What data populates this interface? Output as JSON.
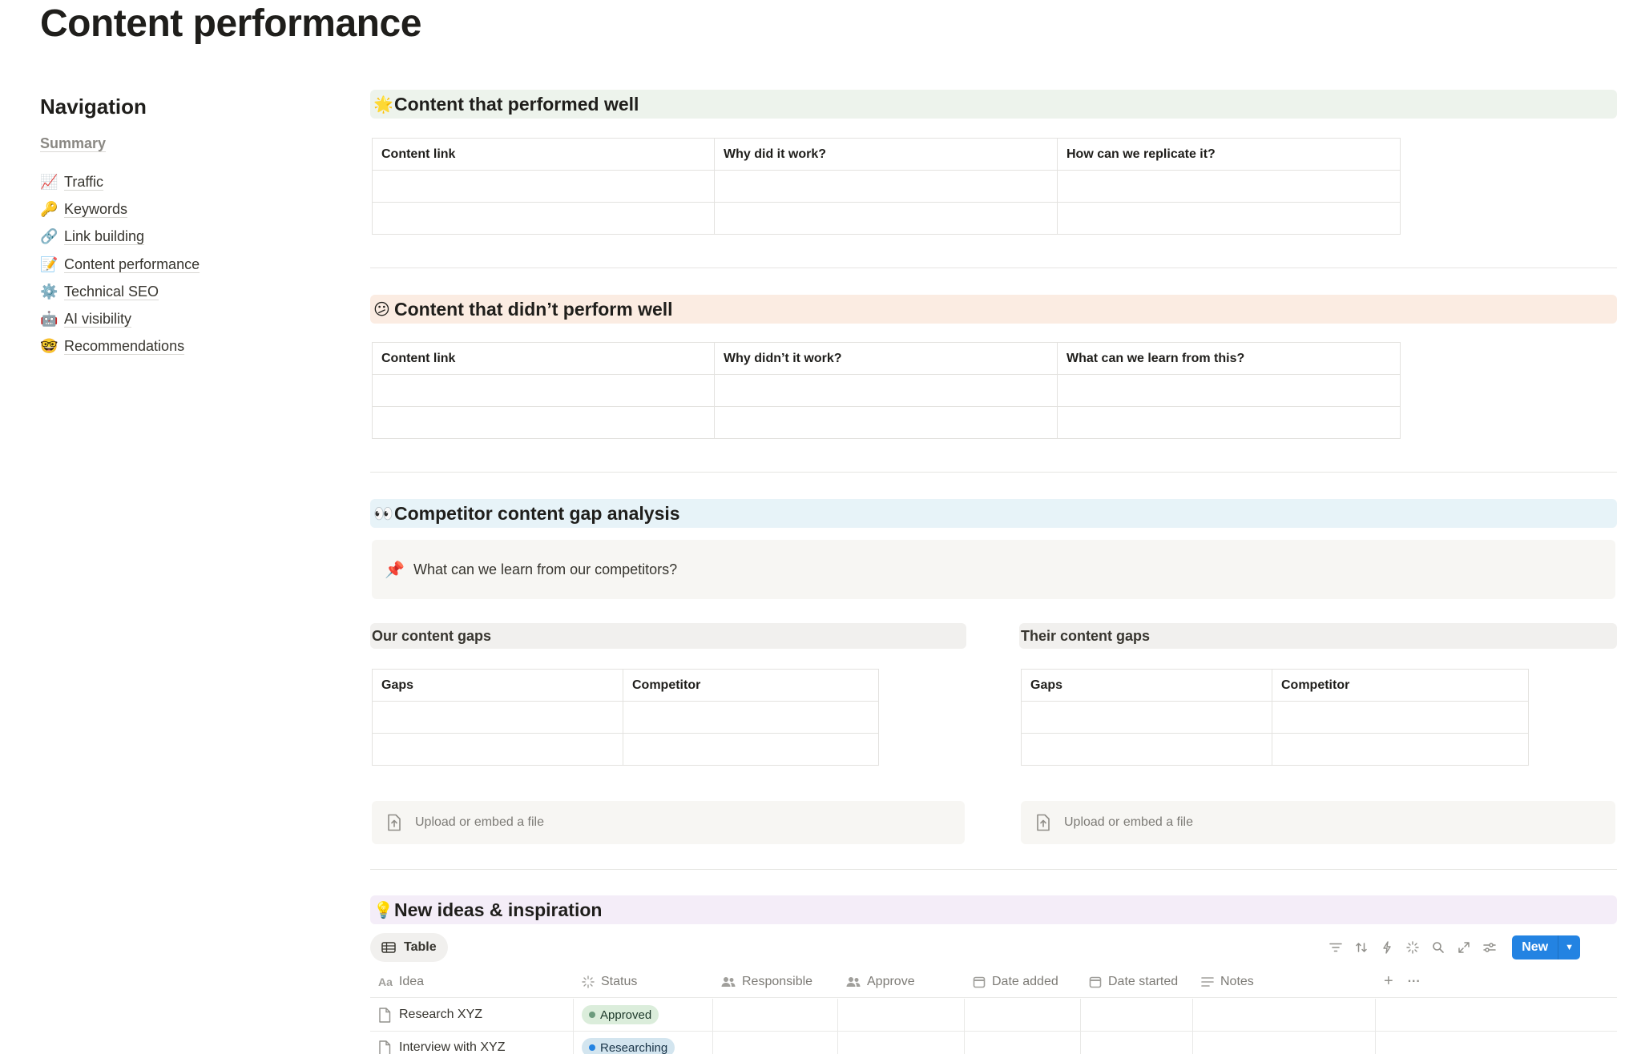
{
  "page": {
    "title": "Content performance"
  },
  "navigation": {
    "heading": "Navigation",
    "summary": "Summary",
    "items": [
      {
        "emoji": "📈",
        "label": "Traffic"
      },
      {
        "emoji": "🔑",
        "label": "Keywords"
      },
      {
        "emoji": "🔗",
        "label": "Link building"
      },
      {
        "emoji": "📝",
        "label": "Content performance"
      },
      {
        "emoji": "⚙️",
        "label": "Technical SEO"
      },
      {
        "emoji": "🤖",
        "label": "AI visibility"
      },
      {
        "emoji": "🤓",
        "label": "Recommendations"
      }
    ]
  },
  "performed_well": {
    "emoji": "🌟",
    "title": "Content that performed well",
    "headers": [
      "Content link",
      "Why did it work?",
      "How can we replicate it?"
    ]
  },
  "did_not_perform": {
    "emoji": "😕",
    "title": "Content that didn’t perform well",
    "headers": [
      "Content link",
      "Why didn’t it work?",
      "What can we learn from this?"
    ]
  },
  "competitor": {
    "emoji": "👀",
    "title": "Competitor content gap analysis",
    "callout": {
      "emoji": "📌",
      "text": "What can we learn from our competitors?"
    },
    "ours": {
      "title": "Our content gaps",
      "headers": [
        "Gaps",
        "Competitor"
      ],
      "upload": "Upload or embed a file"
    },
    "theirs": {
      "title": "Their content gaps",
      "headers": [
        "Gaps",
        "Competitor"
      ],
      "upload": "Upload or embed a file"
    }
  },
  "ideas": {
    "emoji": "💡",
    "title": "New ideas & inspiration",
    "view_tab": "Table",
    "new_button": "New",
    "columns": [
      "Idea",
      "Status",
      "Responsible",
      "Approve",
      "Date added",
      "Date started",
      "Notes"
    ],
    "add_column": "+",
    "more": "···",
    "rows": [
      {
        "idea": "Research XYZ",
        "status": "Approved",
        "status_color": "#6c9b7d"
      },
      {
        "idea": "Interview with XYZ",
        "status": "Researching",
        "status_color": "#2383e2"
      }
    ]
  }
}
